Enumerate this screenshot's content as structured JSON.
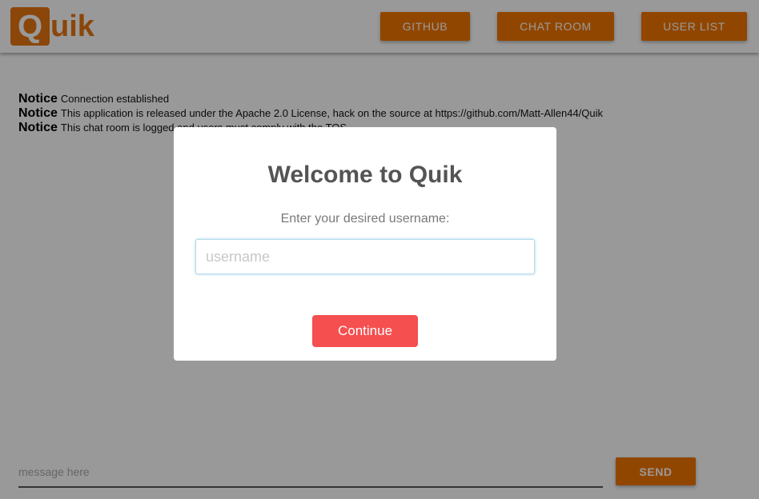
{
  "header": {
    "logo_initial": "Q",
    "logo_rest": "uik",
    "nav": {
      "github": "GITHUB",
      "chat_room": "CHAT ROOM",
      "user_list": "USER LIST"
    }
  },
  "messages": [
    {
      "tag": "Notice",
      "text": "Connection established"
    },
    {
      "tag": "Notice",
      "text": "This application is released under the Apache 2.0 License, hack on the source at https://github.com/Matt-Allen44/Quik"
    },
    {
      "tag": "Notice",
      "text": "This chat room is logged and users must comply with the TOS"
    }
  ],
  "composer": {
    "placeholder": "message here",
    "send_label": "SEND"
  },
  "modal": {
    "title": "Welcome to Quik",
    "subtitle": "Enter your desired username:",
    "input_placeholder": "username",
    "continue_label": "Continue"
  },
  "colors": {
    "accent": "#f27500",
    "logo": "#e87511",
    "continue_button": "#f54f4f"
  }
}
